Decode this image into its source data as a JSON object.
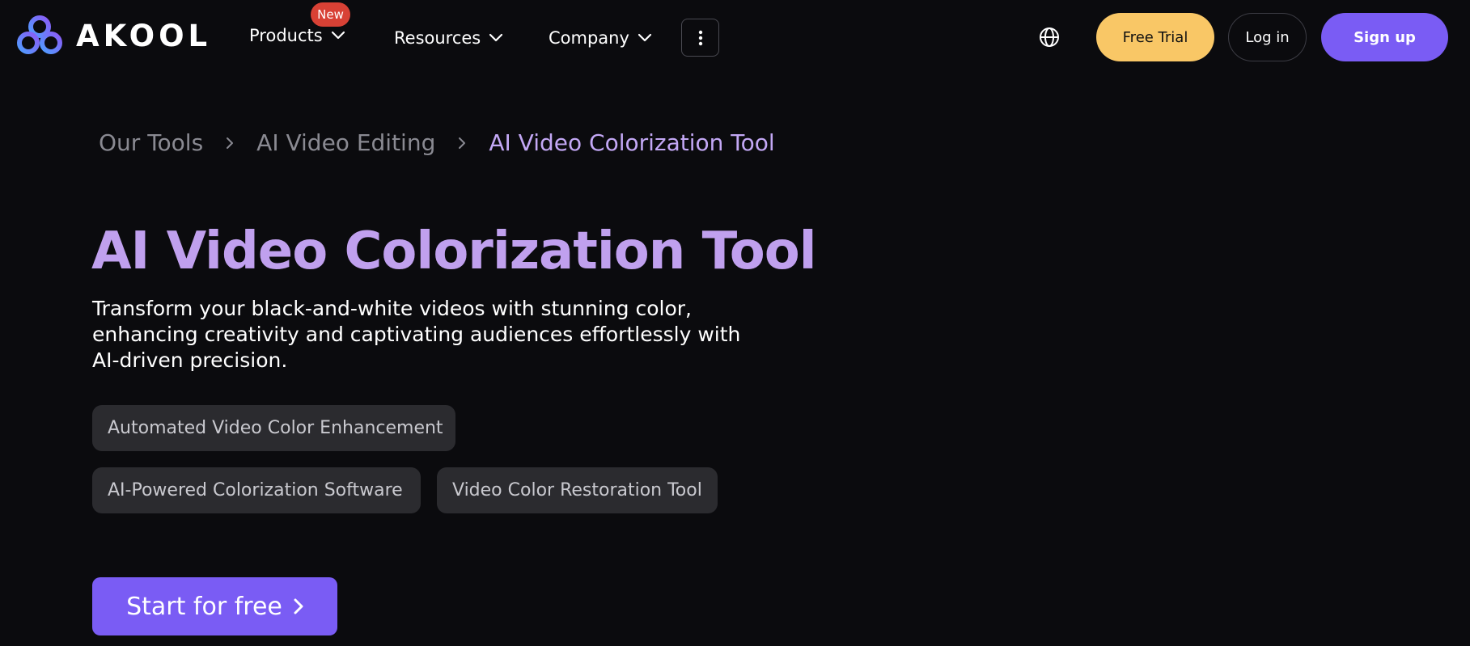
{
  "brand": {
    "name": "AKOOL",
    "logo_colors": [
      "#5b8cff",
      "#8a5cf6"
    ]
  },
  "nav": {
    "products": {
      "label": "Products",
      "badge": "New",
      "badge_color": "#d84135"
    },
    "resources": {
      "label": "Resources"
    },
    "company": {
      "label": "Company"
    },
    "more_icon": "vertical-dots-icon",
    "language_icon": "globe-icon"
  },
  "header_actions": {
    "free_trial": "Free Trial",
    "login": "Log in",
    "signup": "Sign up",
    "colors": {
      "trial": "#f9c766",
      "signup": "#7a5cf4"
    }
  },
  "breadcrumb": {
    "items": [
      "Our Tools",
      "AI Video Editing",
      "AI Video Colorization Tool"
    ]
  },
  "hero": {
    "title": "AI Video Colorization Tool",
    "subtitle": "Transform your black-and-white videos with stunning color, enhancing creativity and captivating audiences effortlessly with AI-driven precision.",
    "tags": [
      "Automated Video Color Enhancement",
      "AI-Powered Colorization Software",
      "Video Color Restoration Tool"
    ],
    "cta": "Start for free",
    "accent_color": "#c0a0ee"
  }
}
